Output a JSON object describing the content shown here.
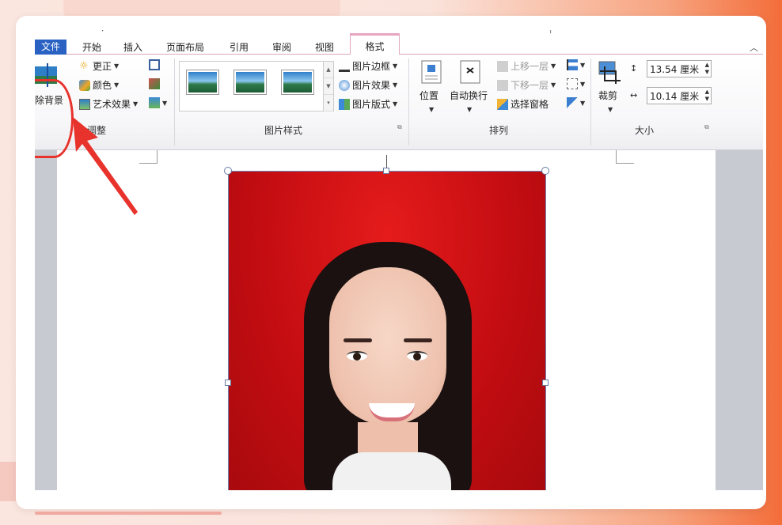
{
  "tabs": [
    {
      "label": "文件"
    },
    {
      "label": "开始"
    },
    {
      "label": "插入"
    },
    {
      "label": "页面布局"
    },
    {
      "label": "引用"
    },
    {
      "label": "审阅"
    },
    {
      "label": "视图"
    },
    {
      "label": "格式"
    }
  ],
  "ribbon": {
    "remove_background": "除背景",
    "adjust": {
      "label": "调整",
      "corrections": "更正",
      "color": "颜色",
      "artistic_effects": "艺术效果"
    },
    "picture_styles": {
      "label": "图片样式",
      "border": "图片边框",
      "effects": "图片效果",
      "layout": "图片版式"
    },
    "arrange": {
      "label": "排列",
      "position": "位置",
      "wrap_text": "自动换行",
      "bring_forward": "上移一层",
      "send_backward": "下移一层",
      "selection_pane": "选择窗格"
    },
    "size": {
      "label": "大小",
      "crop": "裁剪",
      "height": "13.54 厘米",
      "width": "10.14 厘米"
    }
  },
  "colors": {
    "accent": "#2a62c3",
    "format_tab": "#e8a4c0",
    "annotation": "#e8322c",
    "photo_background": "#c40d12"
  }
}
